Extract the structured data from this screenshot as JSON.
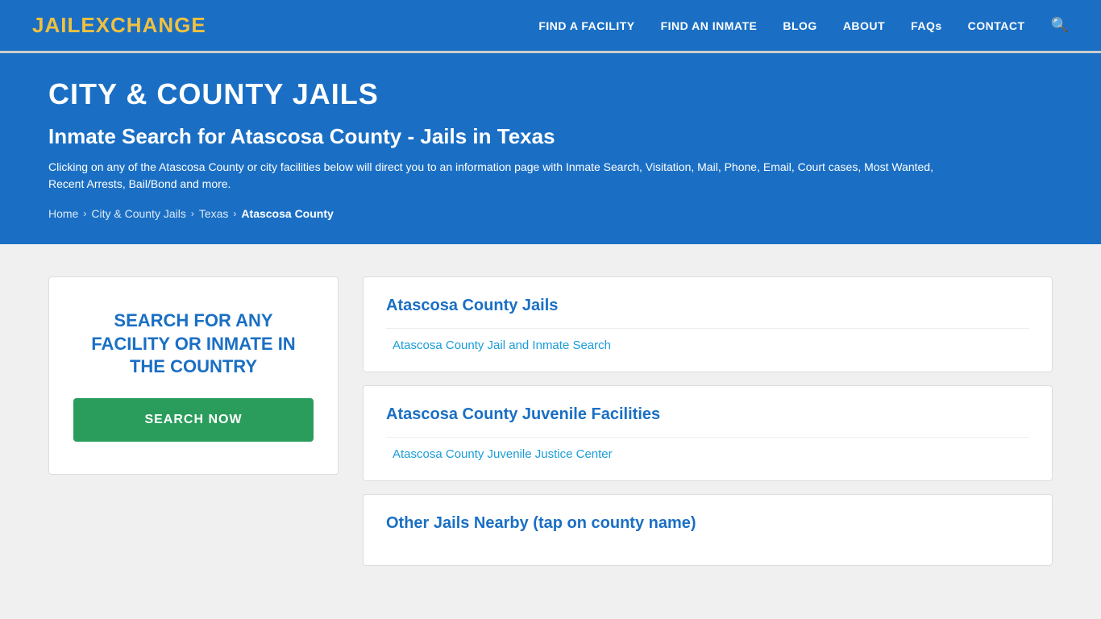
{
  "header": {
    "logo_jail": "JAIL",
    "logo_exchange": "EXCHANGE",
    "nav": [
      {
        "label": "FIND A FACILITY",
        "id": "find-facility"
      },
      {
        "label": "FIND AN INMATE",
        "id": "find-inmate"
      },
      {
        "label": "BLOG",
        "id": "blog"
      },
      {
        "label": "ABOUT",
        "id": "about"
      },
      {
        "label": "FAQs",
        "id": "faqs"
      },
      {
        "label": "CONTACT",
        "id": "contact"
      }
    ]
  },
  "hero": {
    "title": "CITY & COUNTY JAILS",
    "subtitle": "Inmate Search for Atascosa County - Jails in Texas",
    "description": "Clicking on any of the Atascosa County or city facilities below will direct you to an information page with Inmate Search, Visitation, Mail, Phone, Email, Court cases, Most Wanted, Recent Arrests, Bail/Bond and more.",
    "breadcrumb": {
      "home": "Home",
      "city_county": "City & County Jails",
      "state": "Texas",
      "current": "Atascosa County"
    }
  },
  "search_box": {
    "title": "SEARCH FOR ANY FACILITY OR INMATE IN THE COUNTRY",
    "button_label": "SEARCH NOW"
  },
  "cards": [
    {
      "title": "Atascosa County Jails",
      "links": [
        {
          "label": "Atascosa County Jail and Inmate Search"
        }
      ]
    },
    {
      "title": "Atascosa County Juvenile Facilities",
      "links": [
        {
          "label": "Atascosa County Juvenile Justice Center"
        }
      ]
    },
    {
      "title": "Other Jails Nearby (tap on county name)",
      "links": []
    }
  ]
}
